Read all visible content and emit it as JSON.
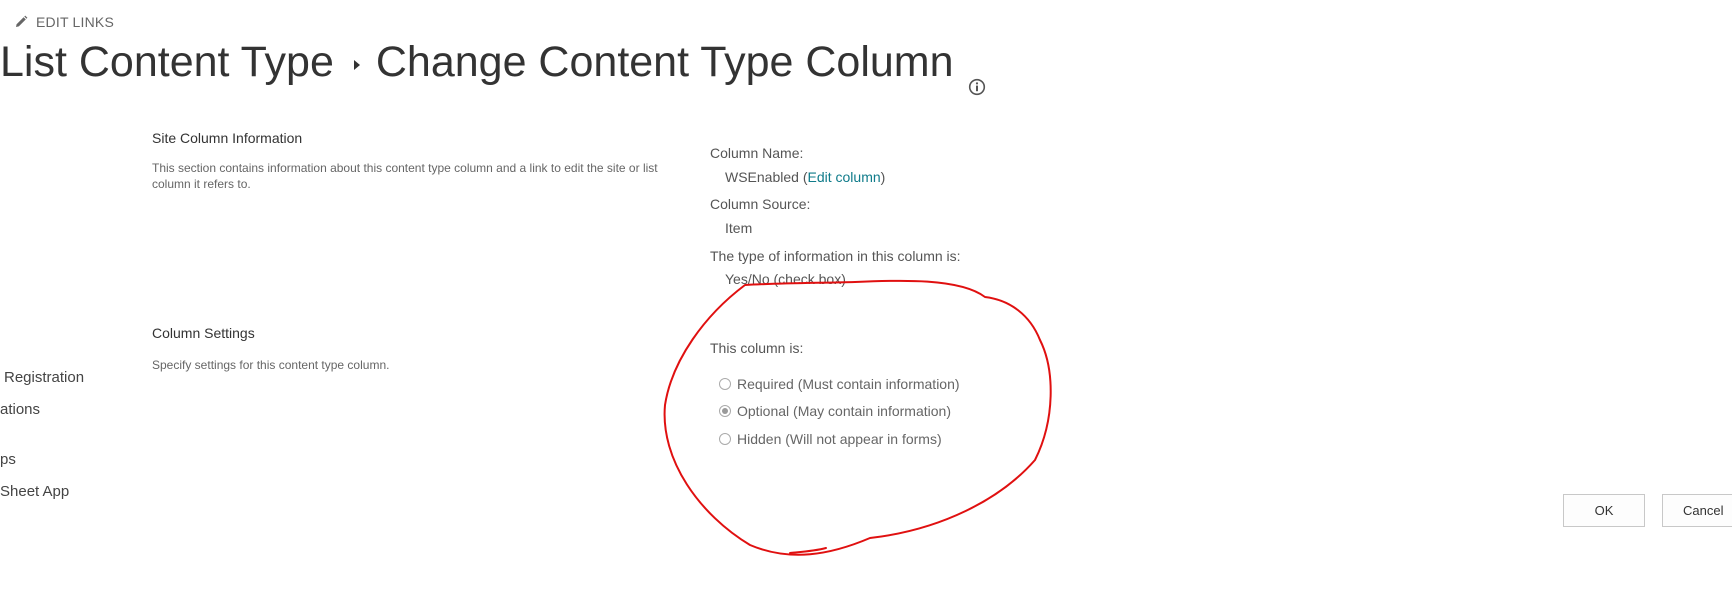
{
  "edit_links": {
    "label": "EDIT LINKS",
    "icon": "pencil-icon"
  },
  "title": {
    "parent": "List Content Type",
    "current": "Change Content Type Column",
    "separator_icon": "breadcrumb-arrow-icon",
    "info_icon": "info-icon"
  },
  "left_nav": {
    "items": [
      {
        "label": "Registration"
      },
      {
        "label": "ations"
      },
      {
        "label": "ps"
      },
      {
        "label": "Sheet App"
      }
    ]
  },
  "site_column_info": {
    "heading": "Site Column Information",
    "description": "This section contains information about this content type column and a link to edit the site or list column it refers to.",
    "column_name_label": "Column Name:",
    "column_name_value": "WSEnabled",
    "open_paren": "(",
    "edit_column_link": "Edit column",
    "close_paren": ")",
    "column_source_label": "Column Source:",
    "column_source_value": "Item",
    "type_label": "The type of information in this column is:",
    "type_value": "Yes/No (check box)"
  },
  "column_settings": {
    "heading": "Column Settings",
    "description": "Specify settings for this content type column.",
    "this_column_label": "This column is:",
    "options": [
      {
        "label": "Required (Must contain information)",
        "checked": false
      },
      {
        "label": "Optional (May contain information)",
        "checked": true
      },
      {
        "label": "Hidden (Will not appear in forms)",
        "checked": false
      }
    ]
  },
  "buttons": {
    "ok": "OK",
    "cancel": "Cancel"
  },
  "annotation": {
    "shape": "hand-drawn-ellipse",
    "color": "#e01010"
  },
  "colors": {
    "link": "#0f7b8a",
    "text": "#333333",
    "muted": "#666666"
  }
}
